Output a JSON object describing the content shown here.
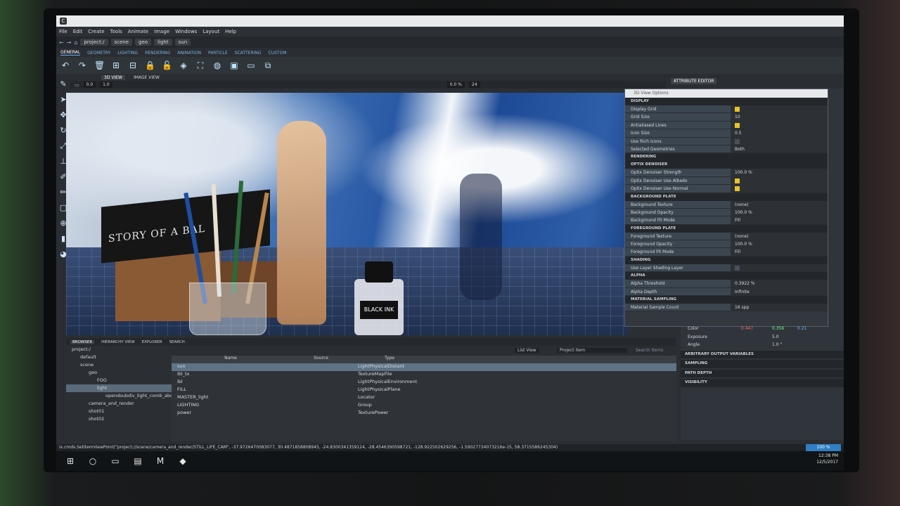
{
  "menubar": [
    "File",
    "Edit",
    "Create",
    "Tools",
    "Animate",
    "Image",
    "Windows",
    "Layout",
    "Help"
  ],
  "breadcrumb": [
    "project:/",
    "scene",
    "geo",
    "light",
    "sun"
  ],
  "shelf_tabs": [
    "GENERAL",
    "GEOMETRY",
    "LIGHTING",
    "RENDERING",
    "ANIMATION",
    "PARTICLE",
    "SCATTERING",
    "CUSTOM"
  ],
  "view_tabs": [
    "3D VIEW",
    "IMAGE VIEW"
  ],
  "viewbar": {
    "a": "0.0",
    "b": "1.0",
    "zoom": "0.0 %",
    "frame": "24"
  },
  "attribute_editor_tab": "ATTRIBUTE EDITOR",
  "dialog": {
    "title": "3D View Options",
    "sections": [
      {
        "name": "DISPLAY",
        "rows": [
          {
            "label": "Display Grid",
            "value": "",
            "check": true
          },
          {
            "label": "Grid Size",
            "value": "10"
          },
          {
            "label": "Antialiased Lines",
            "value": "",
            "check": true
          },
          {
            "label": "Icon Size",
            "value": "0.5"
          },
          {
            "label": "Use Rich Icons",
            "value": "",
            "check": false
          },
          {
            "label": "Selected Geometries",
            "value": "Both"
          }
        ]
      },
      {
        "name": "RENDERING",
        "rows": []
      },
      {
        "name": "OPTIX DENOISER",
        "rows": [
          {
            "label": "Optix Denoiser Strength",
            "value": "100.0 %"
          },
          {
            "label": "Optix Denoiser Use Albedo",
            "value": "",
            "check": true
          },
          {
            "label": "Optix Denoiser Use Normal",
            "value": "",
            "check": true
          }
        ]
      },
      {
        "name": "BACKGROUND PLATE",
        "rows": [
          {
            "label": "Background Texture",
            "value": "(none)"
          },
          {
            "label": "Background Opacity",
            "value": "100.0 %"
          },
          {
            "label": "Background Fit Mode",
            "value": "Fill"
          }
        ]
      },
      {
        "name": "FOREGROUND PLATE",
        "rows": [
          {
            "label": "Foreground Texture",
            "value": "(none)"
          },
          {
            "label": "Foreground Opacity",
            "value": "100.0 %"
          },
          {
            "label": "Foreground Fit Mode",
            "value": "Fill"
          }
        ]
      },
      {
        "name": "SHADING",
        "rows": [
          {
            "label": "Use Layer Shading Layer",
            "value": "",
            "check": false
          }
        ]
      },
      {
        "name": "ALPHA",
        "rows": [
          {
            "label": "Alpha Threshold",
            "value": "0.3922 %"
          },
          {
            "label": "Alpha Depth",
            "value": "Infinite"
          }
        ]
      },
      {
        "name": "MATERIAL SAMPLING",
        "rows": [
          {
            "label": "Material Sample Count",
            "value": "16 spp"
          }
        ]
      }
    ]
  },
  "attr_editor": {
    "color_label": "Color",
    "color_r": "0.447",
    "color_g": "0.356",
    "color_b": "0.21",
    "exposure_label": "Exposure",
    "exposure": "5.0",
    "angle_label": "Angle",
    "angle": "1.0 °",
    "sections": [
      "ARBITRARY OUTPUT VARIABLES",
      "SAMPLING",
      "PATH DEPTH",
      "VISIBILITY"
    ]
  },
  "browser_tabs": [
    "BROWSER",
    "HIERARCHY VIEW",
    "EXPLORER",
    "SEARCH"
  ],
  "tree": [
    "project:/",
    "default",
    "scene",
    "geo",
    "FOG",
    "light",
    "opendsubdiv_light_comb_abc",
    "camera_and_render",
    "shot01",
    "shot02"
  ],
  "list": {
    "view_mode": "List View",
    "filter": "Project Item",
    "search_placeholder": "Search Items",
    "headers": [
      "Name",
      "Source",
      "Type"
    ],
    "rows": [
      {
        "name": "sun",
        "source": "",
        "type": "LightPhysicalDistant"
      },
      {
        "name": "ibl_tx",
        "source": "",
        "type": "TextureMapFile"
      },
      {
        "name": "ibl",
        "source": "",
        "type": "LightPhysicalEnvironment"
      },
      {
        "name": "FILL",
        "source": "",
        "type": "LightPhysicalPlane"
      },
      {
        "name": "MASTER_light",
        "source": "",
        "type": "Locator"
      },
      {
        "name": "LIGHTING",
        "source": "",
        "type": "Group"
      },
      {
        "name": "power",
        "source": "",
        "type": "TexturePower"
      }
    ]
  },
  "viewport_labels": {
    "book": "STORY OF A BAL",
    "ink": "BLACK INK"
  },
  "cmdline": "ix.cmds.SetItemViewPoint(\"project://scene/camera_and_render/STILL_LIFE_CAM\", -37.9726470083077, 30.4871858808945, -24.8300341359124, -28.4546390598721, -128.922502629256, -1.59027734073216e-15, 58.3715586245304)",
  "clock": {
    "time": "12:38 PM",
    "date": "12/5/2017"
  },
  "status_pct": "100 %"
}
